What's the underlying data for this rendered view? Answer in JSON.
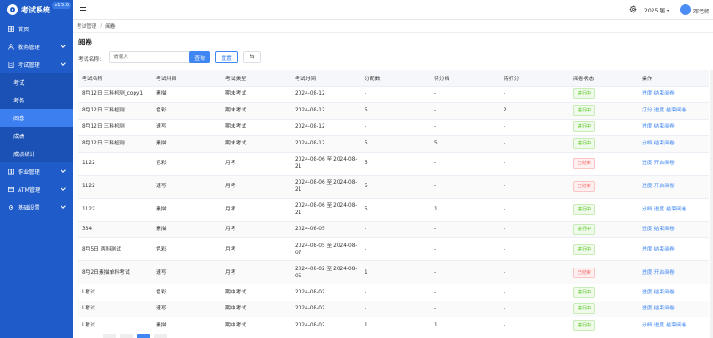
{
  "app": {
    "name": "考试系统",
    "version": "v1.5.0"
  },
  "header": {
    "year": "2025 届",
    "user": "邓老师"
  },
  "sidebar": {
    "items": [
      {
        "label": "首页",
        "icon": "home-icon",
        "sub": false,
        "active": false,
        "caret": false
      },
      {
        "label": "教务管理",
        "icon": "user-icon",
        "sub": false,
        "active": false,
        "caret": true
      },
      {
        "label": "考试管理",
        "icon": "doc-icon",
        "sub": false,
        "active": false,
        "caret": true
      },
      {
        "label": "考试",
        "icon": "",
        "sub": true,
        "active": false,
        "caret": false
      },
      {
        "label": "考务",
        "icon": "",
        "sub": true,
        "active": false,
        "caret": false
      },
      {
        "label": "阅卷",
        "icon": "",
        "sub": true,
        "active": true,
        "caret": false
      },
      {
        "label": "成绩",
        "icon": "",
        "sub": true,
        "active": false,
        "caret": false
      },
      {
        "label": "成绩统计",
        "icon": "",
        "sub": true,
        "active": false,
        "caret": false
      },
      {
        "label": "作业管理",
        "icon": "book-icon",
        "sub": false,
        "active": false,
        "caret": true
      },
      {
        "label": "ATM管理",
        "icon": "atm-icon",
        "sub": false,
        "active": false,
        "caret": true
      },
      {
        "label": "基础设置",
        "icon": "gear-icon",
        "sub": false,
        "active": false,
        "caret": true
      }
    ]
  },
  "breadcrumb": {
    "parent": "考试管理",
    "current": "阅卷"
  },
  "page": {
    "title": "阅卷",
    "search_label": "考试名称:",
    "search_placeholder": "请输入",
    "query_btn": "查询",
    "reset_btn": "重置",
    "icon_btn": "⇆"
  },
  "table": {
    "headers": [
      "考试名称",
      "考试科目",
      "考试类型",
      "考试时间",
      "分配数",
      "待分档",
      "待打分",
      "阅卷状态",
      "操作"
    ],
    "rows": [
      {
        "name": "8月12日 三科检测_copy1",
        "subject": "素描",
        "type": "期末考试",
        "time": "2024-08-12",
        "assigned": "-",
        "pending_grade": "-",
        "pending_score": "-",
        "status": "进行中",
        "status_type": "run",
        "ops": [
          "进度",
          "结束阅卷"
        ],
        "tall": false
      },
      {
        "name": "8月12日 三科检测",
        "subject": "色彩",
        "type": "期末考试",
        "time": "2024-08-12",
        "assigned": "5",
        "pending_grade": "-",
        "pending_score": "2",
        "status": "进行中",
        "status_type": "run",
        "ops": [
          "打分",
          "进度",
          "结束阅卷"
        ],
        "tall": false
      },
      {
        "name": "8月12日 三科检测",
        "subject": "速写",
        "type": "期末考试",
        "time": "2024-08-12",
        "assigned": "-",
        "pending_grade": "-",
        "pending_score": "-",
        "status": "进行中",
        "status_type": "run",
        "ops": [
          "进度",
          "结束阅卷"
        ],
        "tall": false
      },
      {
        "name": "8月12日 三科检测",
        "subject": "素描",
        "type": "期末考试",
        "time": "2024-08-12",
        "assigned": "5",
        "pending_grade": "5",
        "pending_score": "-",
        "status": "进行中",
        "status_type": "run",
        "ops": [
          "分档",
          "结束阅卷"
        ],
        "tall": false
      },
      {
        "name": "1122",
        "subject": "色彩",
        "type": "月考",
        "time": "2024-08-06 至 2024-08-21",
        "assigned": "5",
        "pending_grade": "-",
        "pending_score": "-",
        "status": "已结束",
        "status_type": "end",
        "ops": [
          "进度",
          "开启阅卷"
        ],
        "tall": true
      },
      {
        "name": "1122",
        "subject": "速写",
        "type": "月考",
        "time": "2024-08-06 至 2024-08-21",
        "assigned": "5",
        "pending_grade": "-",
        "pending_score": "-",
        "status": "已结束",
        "status_type": "end",
        "ops": [
          "进度",
          "开启阅卷"
        ],
        "tall": true
      },
      {
        "name": "1122",
        "subject": "素描",
        "type": "月考",
        "time": "2024-08-06 至 2024-08-21",
        "assigned": "5",
        "pending_grade": "1",
        "pending_score": "-",
        "status": "进行中",
        "status_type": "run",
        "ops": [
          "分档",
          "进度",
          "结束阅卷"
        ],
        "tall": true
      },
      {
        "name": "334",
        "subject": "素描",
        "type": "月考",
        "time": "2024-08-05",
        "assigned": "-",
        "pending_grade": "-",
        "pending_score": "-",
        "status": "进行中",
        "status_type": "run",
        "ops": [
          "进度",
          "结束阅卷"
        ],
        "tall": false
      },
      {
        "name": "8月5日 两科测试",
        "subject": "色彩",
        "type": "月考",
        "time": "2024-08-05 至 2024-08-07",
        "assigned": "-",
        "pending_grade": "-",
        "pending_score": "-",
        "status": "进行中",
        "status_type": "run",
        "ops": [
          "进度",
          "结束阅卷"
        ],
        "tall": true
      },
      {
        "name": "8月2日素描单科考试",
        "subject": "速写",
        "type": "月考",
        "time": "2024-08-02 至 2024-08-05",
        "assigned": "1",
        "pending_grade": "-",
        "pending_score": "-",
        "status": "已结束",
        "status_type": "end",
        "ops": [
          "进度",
          "开启阅卷"
        ],
        "tall": true
      },
      {
        "name": "L考试",
        "subject": "色彩",
        "type": "期中考试",
        "time": "2024-08-02",
        "assigned": "-",
        "pending_grade": "-",
        "pending_score": "-",
        "status": "进行中",
        "status_type": "run",
        "ops": [
          "进度",
          "结束阅卷"
        ],
        "tall": false
      },
      {
        "name": "L考试",
        "subject": "速写",
        "type": "期中考试",
        "time": "2024-08-02",
        "assigned": "-",
        "pending_grade": "-",
        "pending_score": "-",
        "status": "进行中",
        "status_type": "run",
        "ops": [
          "进度",
          "结束阅卷"
        ],
        "tall": false
      },
      {
        "name": "L考试",
        "subject": "素描",
        "type": "期中考试",
        "time": "2024-08-02",
        "assigned": "1",
        "pending_grade": "1",
        "pending_score": "-",
        "status": "进行中",
        "status_type": "run",
        "ops": [
          "分档",
          "进度",
          "结束阅卷"
        ],
        "tall": false
      }
    ]
  },
  "colors": {
    "sidebar": "#1f5cc9",
    "accent": "#3f86f3",
    "success": "#52c41a",
    "danger": "#f56c6c"
  }
}
